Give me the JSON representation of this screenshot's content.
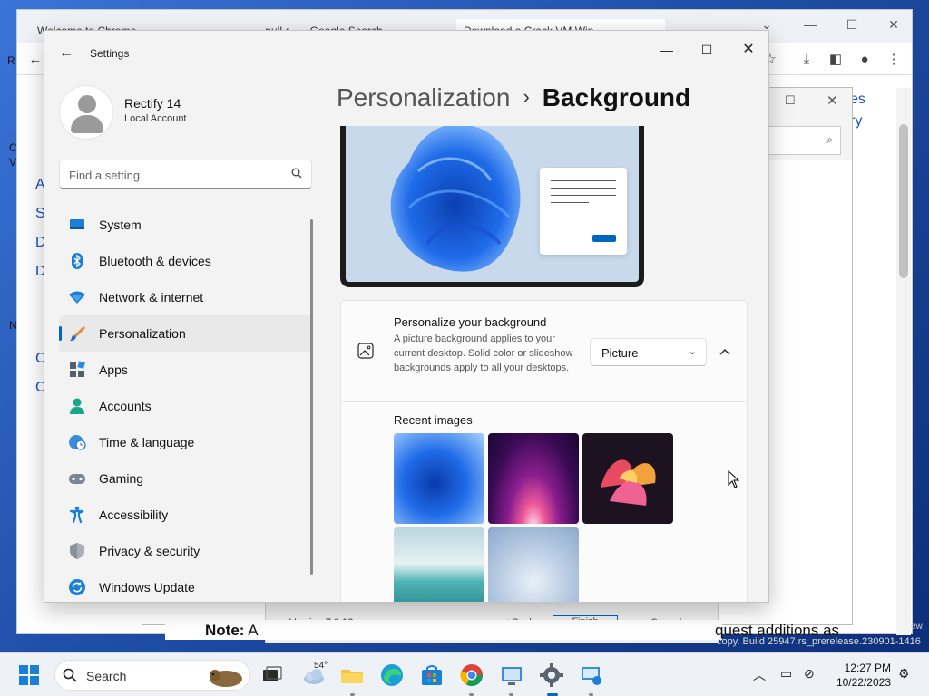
{
  "browser": {
    "tabs": [
      "Welcome to Chrome",
      "… pull-r… - Google Search",
      "Download a Crack VM Win…"
    ],
    "left_letters": [
      "R",
      "C",
      "V",
      "A",
      "S",
      "D",
      "D",
      "N",
      "C",
      "C"
    ],
    "right_links": [
      "es",
      "ry"
    ],
    "note_bold": "Note:",
    "note_prefix": "A",
    "note_suffix": "quest additions as",
    "version_text": "Version 7.0.12",
    "dialog_buttons": [
      "< Back",
      "Finish",
      "Cancel"
    ],
    "build_text": "copy. Build 25947.rs_prerelease.230901-1416",
    "partial_text": "ew"
  },
  "settings": {
    "window_title": "Settings",
    "profile": {
      "name": "Rectify 14",
      "account": "Local Account"
    },
    "search_placeholder": "Find a setting",
    "nav": [
      {
        "label": "System",
        "icon": "system-icon"
      },
      {
        "label": "Bluetooth & devices",
        "icon": "bluetooth-icon"
      },
      {
        "label": "Network & internet",
        "icon": "wifi-icon"
      },
      {
        "label": "Personalization",
        "icon": "brush-icon",
        "active": true
      },
      {
        "label": "Apps",
        "icon": "apps-icon"
      },
      {
        "label": "Accounts",
        "icon": "accounts-icon"
      },
      {
        "label": "Time & language",
        "icon": "globe-clock-icon"
      },
      {
        "label": "Gaming",
        "icon": "gamepad-icon"
      },
      {
        "label": "Accessibility",
        "icon": "accessibility-icon"
      },
      {
        "label": "Privacy & security",
        "icon": "shield-icon"
      },
      {
        "label": "Windows Update",
        "icon": "update-icon"
      }
    ],
    "breadcrumb": {
      "parent": "Personalization",
      "separator": "›",
      "current": "Background"
    },
    "background_card": {
      "title": "Personalize your background",
      "description": "A picture background applies to your current desktop. Solid color or slideshow backgrounds apply to all your desktops.",
      "dropdown_value": "Picture",
      "recent_label": "Recent images"
    }
  },
  "taskbar": {
    "search_label": "Search",
    "weather_temp": "54°",
    "time": "12:27 PM",
    "date": "10/22/2023"
  },
  "colors": {
    "accent": "#0067c0",
    "desktop": "#2a5fb8"
  }
}
